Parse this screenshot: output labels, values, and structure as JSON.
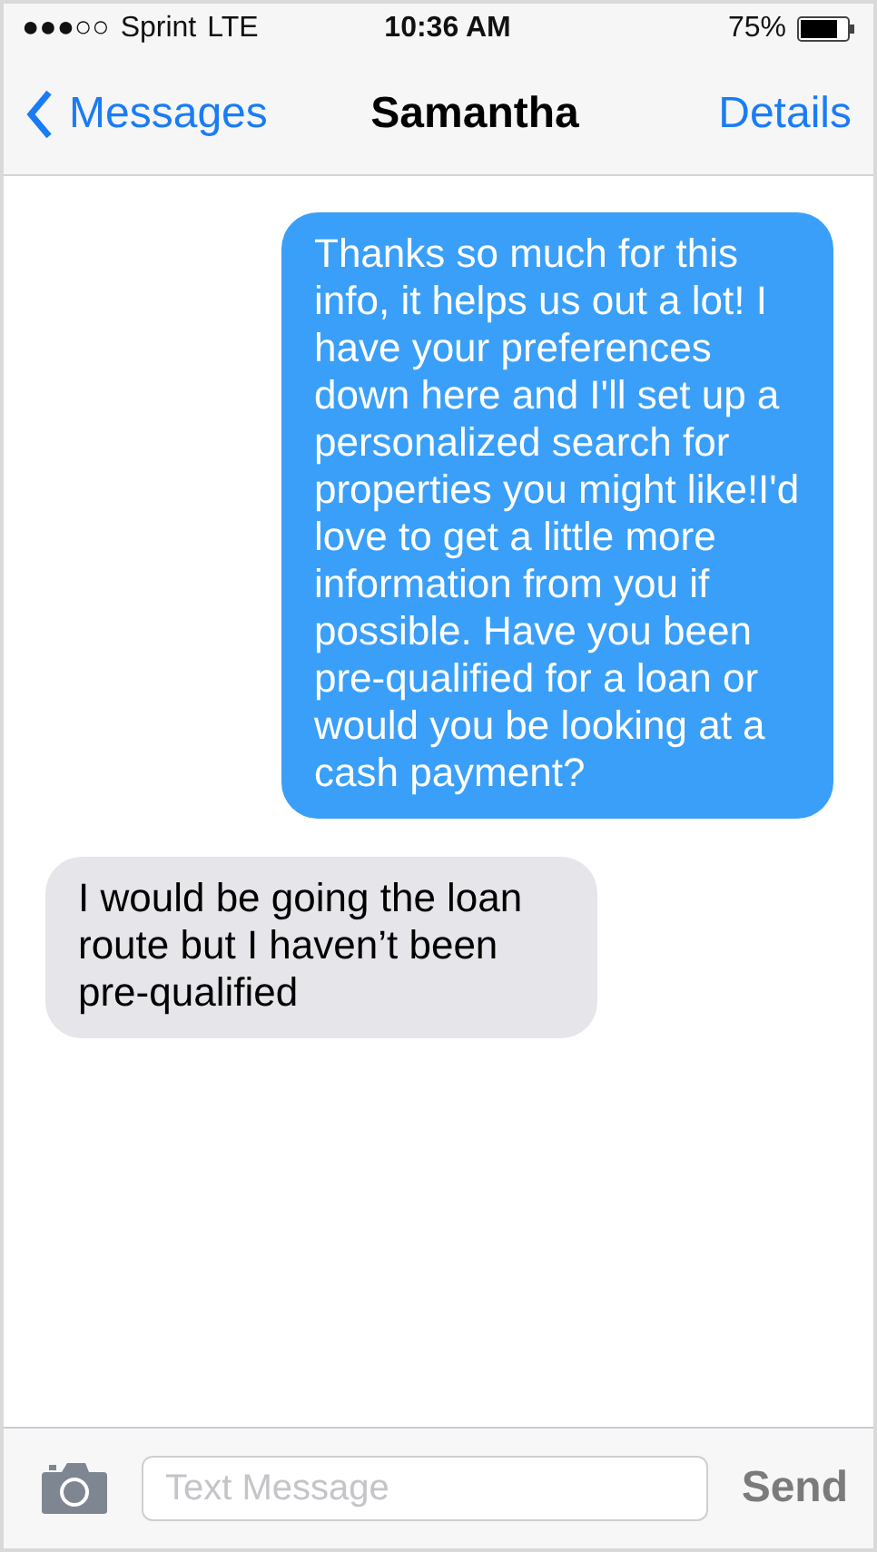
{
  "status_bar": {
    "signal": "●●●○○",
    "carrier": "Sprint",
    "network": "LTE",
    "time": "10:36 AM",
    "battery": "75%"
  },
  "nav": {
    "back": "Messages",
    "title": "Samantha",
    "action": "Details"
  },
  "messages": [
    {
      "kind": "sent",
      "text": "Thanks so much for this info, it helps us out a lot! I have your preferences down here and I'll set up a personalized search for properties you might like!I'd love to get a little more information from you if possible. Have you been pre-qualified for a loan or would you be looking at a cash payment?"
    },
    {
      "kind": "received",
      "text": "I would be going the loan route but I haven’t been pre-qualified"
    }
  ],
  "composer": {
    "placeholder": "Text Message",
    "send": "Send"
  }
}
